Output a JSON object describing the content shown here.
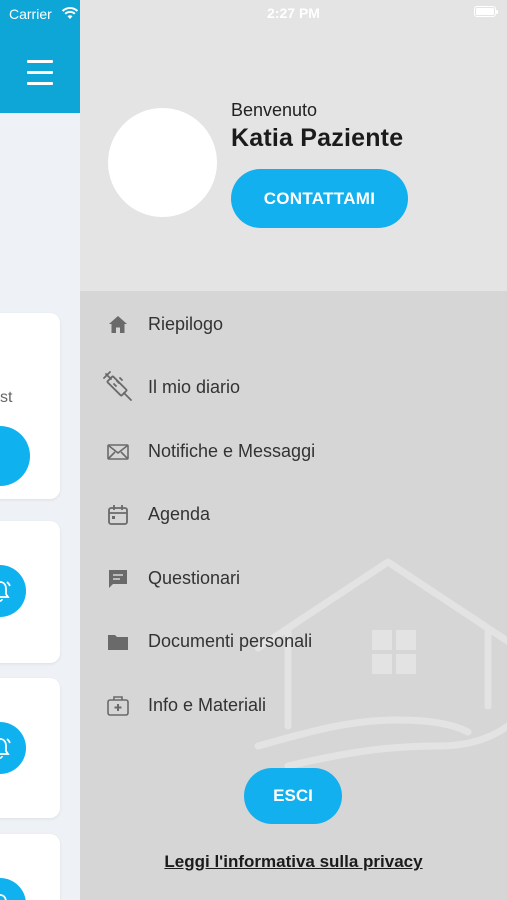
{
  "status_bar": {
    "carrier": "Carrier",
    "time": "2:27 PM"
  },
  "background_app": {
    "card1_text": "st"
  },
  "drawer": {
    "welcome": "Benvenuto",
    "user_name": "Katia Paziente",
    "contact_label": "CONTATTAMI",
    "menu": [
      {
        "label": "Riepilogo",
        "icon": "home-icon"
      },
      {
        "label": "Il mio diario",
        "icon": "syringe-icon"
      },
      {
        "label": "Notifiche e Messaggi",
        "icon": "envelope-icon"
      },
      {
        "label": "Agenda",
        "icon": "calendar-icon"
      },
      {
        "label": "Questionari",
        "icon": "chat-icon"
      },
      {
        "label": "Documenti personali",
        "icon": "folder-icon"
      },
      {
        "label": "Info e Materiali",
        "icon": "medkit-icon"
      }
    ],
    "logout_label": "ESCI",
    "privacy_label": "Leggi l'informativa sulla privacy"
  },
  "colors": {
    "accent": "#12b0ef",
    "header": "#0ea5d7",
    "drawer_top": "#e4e4e4",
    "drawer_body": "#d6d6d6"
  }
}
